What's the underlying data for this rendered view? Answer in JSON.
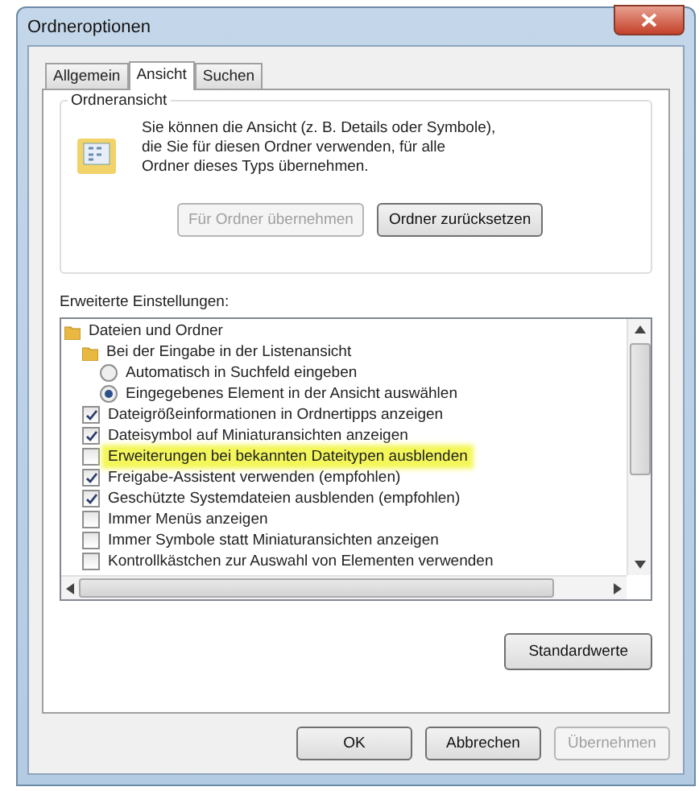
{
  "window": {
    "title": "Ordneroptionen"
  },
  "tabs": [
    {
      "label": "Allgemein",
      "selected": false
    },
    {
      "label": "Ansicht",
      "selected": true
    },
    {
      "label": "Suchen",
      "selected": false
    }
  ],
  "folder_view": {
    "title": "Ordneransicht",
    "description": "Sie können die Ansicht (z. B. Details oder Symbole), die Sie für diesen Ordner verwenden, für alle Ordner dieses Typs übernehmen.",
    "buttons": [
      {
        "label": "Für Ordner übernehmen",
        "disabled": true
      },
      {
        "label": "Ordner zurücksetzen",
        "disabled": false
      }
    ]
  },
  "advanced": {
    "title": "Erweiterte Einstellungen:",
    "items": [
      {
        "kind": "folder",
        "label": "Dateien und Ordner",
        "highlighted": false,
        "children": [
          {
            "kind": "folder",
            "label": "Bei der Eingabe in der Listenansicht",
            "highlighted": false,
            "children": [
              {
                "kind": "radio",
                "label": "Automatisch in Suchfeld eingeben",
                "selected": false,
                "highlighted": false
              },
              {
                "kind": "radio",
                "label": "Eingegebenes Element in der Ansicht auswählen",
                "selected": true,
                "highlighted": false
              }
            ]
          },
          {
            "kind": "checkbox",
            "label": "Dateigrößeinformationen in Ordnertipps anzeigen",
            "checked": true,
            "highlighted": false
          },
          {
            "kind": "checkbox",
            "label": "Dateisymbol auf Miniaturansichten anzeigen",
            "checked": true,
            "highlighted": false
          },
          {
            "kind": "checkbox",
            "label": "Erweiterungen bei bekannten Dateitypen ausblenden",
            "checked": false,
            "highlighted": true
          },
          {
            "kind": "checkbox",
            "label": "Freigabe-Assistent verwenden (empfohlen)",
            "checked": true,
            "highlighted": false
          },
          {
            "kind": "checkbox",
            "label": "Geschützte Systemdateien ausblenden (empfohlen)",
            "checked": true,
            "highlighted": false
          },
          {
            "kind": "checkbox",
            "label": "Immer Menüs anzeigen",
            "checked": false,
            "highlighted": false
          },
          {
            "kind": "checkbox",
            "label": "Immer Symbole statt Miniaturansichten anzeigen",
            "checked": false,
            "highlighted": false
          },
          {
            "kind": "checkbox",
            "label": "Kontrollkästchen zur Auswahl von Elementen verwenden",
            "checked": false,
            "highlighted": false
          }
        ]
      }
    ],
    "reset_button": {
      "label": "Standardwerte",
      "disabled": false
    }
  },
  "buttons": [
    {
      "label": "OK",
      "disabled": false
    },
    {
      "label": "Abbrechen",
      "disabled": false
    },
    {
      "label": "Übernehmen",
      "disabled": true
    }
  ]
}
